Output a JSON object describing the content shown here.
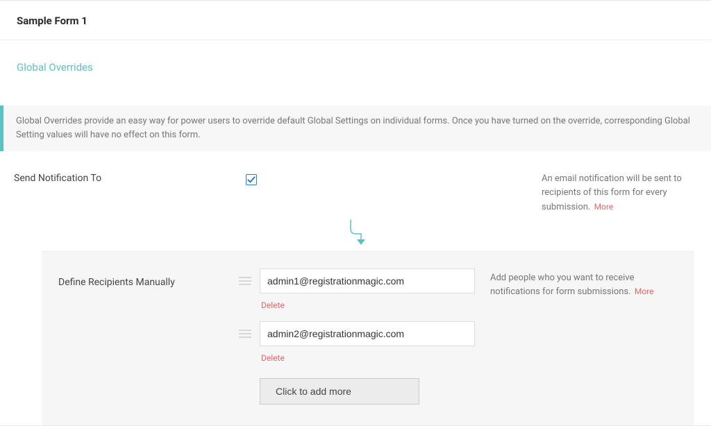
{
  "header": {
    "title": "Sample Form 1"
  },
  "section": {
    "title": "Global Overrides",
    "info": "Global Overrides provide an easy way for power users to override default Global Settings on individual forms. Once you have turned on the override, corresponding Global Setting values will have no effect on this form."
  },
  "notification": {
    "label": "Send Notification To",
    "enabled": true,
    "desc": "An email notification will be sent to recipients of this form for every submission.",
    "more": "More"
  },
  "recipients": {
    "label": "Define Recipients Manually",
    "desc": "Add people who you want to receive notifications for form submissions.",
    "more": "More",
    "delete_label": "Delete",
    "add_more_label": "Click to add more",
    "entries": [
      {
        "email": "admin1@registrationmagic.com"
      },
      {
        "email": "admin2@registrationmagic.com"
      }
    ]
  }
}
